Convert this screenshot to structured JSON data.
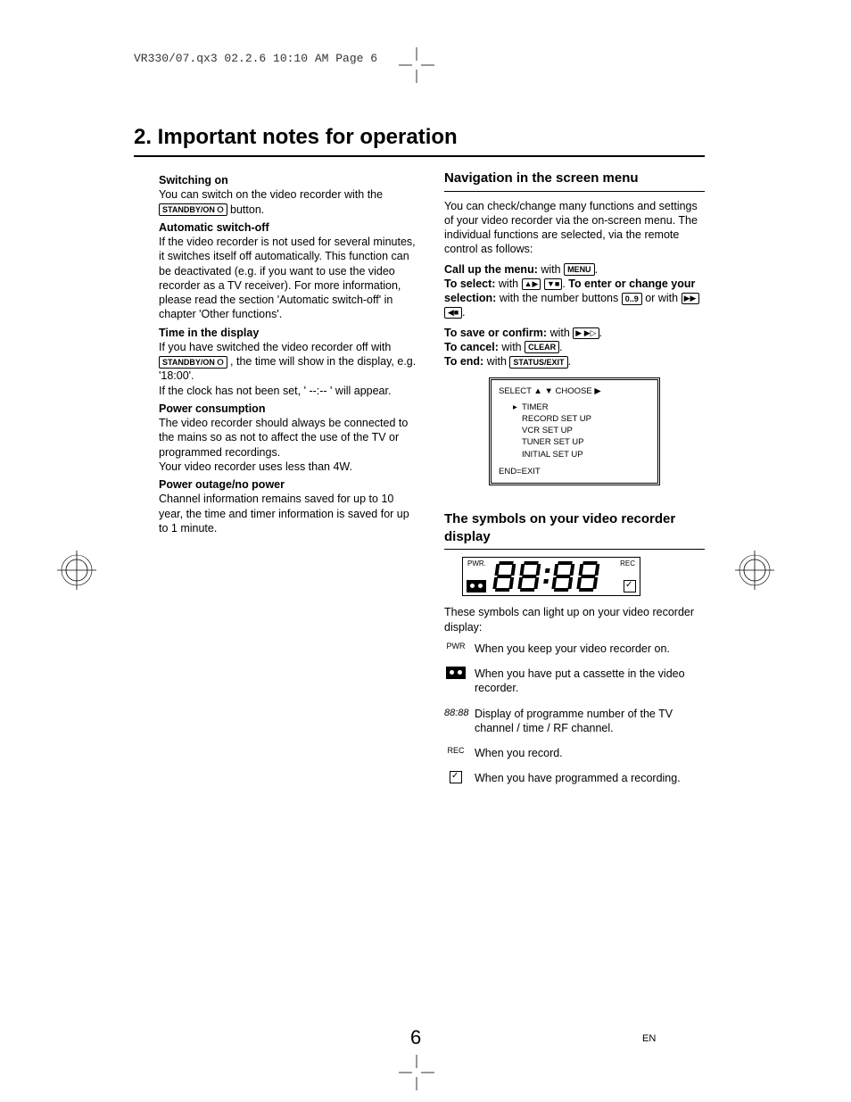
{
  "print_header": "VR330/07.qx3  02.2.6  10:10 AM  Page 6",
  "title": "2. Important notes for operation",
  "left": {
    "switching_on_h": "Switching on",
    "switching_on_1": "You can switch on the video recorder with the ",
    "standby_btn": "STANDBY/ON ⭘",
    "switching_on_2": " button.",
    "auto_off_h": "Automatic switch-off",
    "auto_off": "If the video recorder is not used for several minutes, it switches itself off automatically. This function can be deactivated (e.g. if you want to use the video recorder as a TV receiver). For more information, please read the section 'Automatic switch-off' in chapter 'Other functions'.",
    "time_h": "Time in the display",
    "time_1": "If you have switched the video recorder off with ",
    "time_2": ", the time will show in the display, e.g. '18:00'.",
    "time_3": "If the clock has not been set, ' --:-- ' will appear.",
    "power_h": "Power consumption",
    "power_1": "The video recorder should always be connected to the mains so as not to affect the use of the TV or programmed recordings.",
    "power_2": "Your video recorder uses less than 4W.",
    "outage_h": "Power outage/no power",
    "outage": "Channel information remains saved for up to 10 year, the time and timer information is saved for up to 1 minute."
  },
  "right": {
    "nav_h": "Navigation in the screen menu",
    "nav_intro": "You can check/change many functions and settings of your video recorder via the on-screen menu. The individual functions are selected, via the remote control as follows:",
    "call_lbl": "Call up the menu:",
    "with": " with ",
    "menu_btn": "MENU",
    "select_lbl": "To select:",
    "up_btn": "▲▶",
    "down_btn": "▼■",
    "enter_lbl": "To enter or change your selection:",
    "num_text": " with the number buttons ",
    "num_btn": "0..9",
    "or_with": " or with ",
    "right_btn": "▶▶",
    "left_btn": "◀■",
    "save_lbl": "To save or confirm:",
    "save_btn": "▶ ▶▷",
    "cancel_lbl": "To cancel:",
    "clear_btn": "CLEAR",
    "end_lbl": "To end:",
    "status_btn": "STATUS/EXIT",
    "osd_top": "SELECT ▲ ▼  CHOOSE ▶",
    "osd_items": [
      "TIMER",
      "RECORD SET UP",
      "VCR SET UP",
      "TUNER SET UP",
      "INITIAL SET UP"
    ],
    "osd_end": "END=EXIT",
    "sym_h": "The symbols on your video recorder display",
    "vfd_pwr": "PWR.",
    "vfd_rec": "REC",
    "sym_intro": "These symbols can light up on your video recorder display:",
    "sym_pwr_lbl": "PWR",
    "sym_pwr": "When you keep your video recorder on.",
    "sym_cas": "When you have put a cassette in the video recorder.",
    "sym_seg_lbl": "88:88",
    "sym_seg": "Display of programme number of the TV channel / time / RF channel.",
    "sym_rec_lbl": "REC",
    "sym_rec": "When you record.",
    "sym_prog": "When you have programmed a recording."
  },
  "page_num": "6",
  "lang": "EN"
}
